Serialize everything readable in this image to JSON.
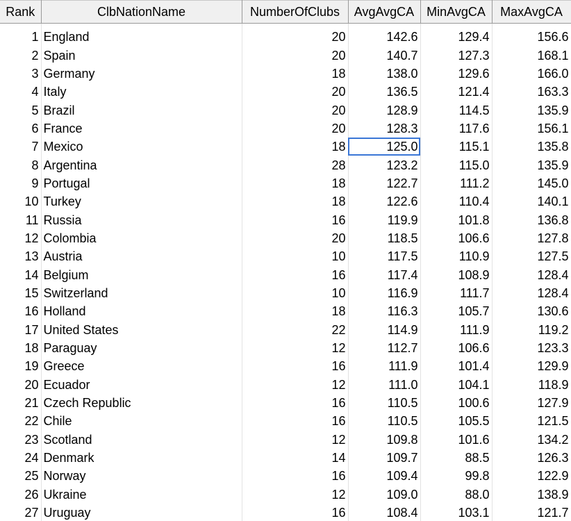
{
  "columns": [
    "Rank",
    "ClbNationName",
    "NumberOfClubs",
    "AvgAvgCA",
    "MinAvgCA",
    "MaxAvgCA"
  ],
  "selected_cell": {
    "row": 7,
    "column": "AvgAvgCA"
  },
  "colors": {
    "header_bg": "#f0f0f0",
    "grid_line": "#e2e2e2",
    "selection": "#3a76d6"
  },
  "rows": [
    {
      "rank": "1",
      "nation": "England",
      "clubs": "20",
      "avg": "142.6",
      "min": "129.4",
      "max": "156.6"
    },
    {
      "rank": "2",
      "nation": "Spain",
      "clubs": "20",
      "avg": "140.7",
      "min": "127.3",
      "max": "168.1"
    },
    {
      "rank": "3",
      "nation": "Germany",
      "clubs": "18",
      "avg": "138.0",
      "min": "129.6",
      "max": "166.0"
    },
    {
      "rank": "4",
      "nation": "Italy",
      "clubs": "20",
      "avg": "136.5",
      "min": "121.4",
      "max": "163.3"
    },
    {
      "rank": "5",
      "nation": "Brazil",
      "clubs": "20",
      "avg": "128.9",
      "min": "114.5",
      "max": "135.9"
    },
    {
      "rank": "6",
      "nation": "France",
      "clubs": "20",
      "avg": "128.3",
      "min": "117.6",
      "max": "156.1"
    },
    {
      "rank": "7",
      "nation": "Mexico",
      "clubs": "18",
      "avg": "125.0",
      "min": "115.1",
      "max": "135.8"
    },
    {
      "rank": "8",
      "nation": "Argentina",
      "clubs": "28",
      "avg": "123.2",
      "min": "115.0",
      "max": "135.9"
    },
    {
      "rank": "9",
      "nation": "Portugal",
      "clubs": "18",
      "avg": "122.7",
      "min": "111.2",
      "max": "145.0"
    },
    {
      "rank": "10",
      "nation": "Turkey",
      "clubs": "18",
      "avg": "122.6",
      "min": "110.4",
      "max": "140.1"
    },
    {
      "rank": "11",
      "nation": "Russia",
      "clubs": "16",
      "avg": "119.9",
      "min": "101.8",
      "max": "136.8"
    },
    {
      "rank": "12",
      "nation": "Colombia",
      "clubs": "20",
      "avg": "118.5",
      "min": "106.6",
      "max": "127.8"
    },
    {
      "rank": "13",
      "nation": "Austria",
      "clubs": "10",
      "avg": "117.5",
      "min": "110.9",
      "max": "127.5"
    },
    {
      "rank": "14",
      "nation": "Belgium",
      "clubs": "16",
      "avg": "117.4",
      "min": "108.9",
      "max": "128.4"
    },
    {
      "rank": "15",
      "nation": "Switzerland",
      "clubs": "10",
      "avg": "116.9",
      "min": "111.7",
      "max": "128.4"
    },
    {
      "rank": "16",
      "nation": "Holland",
      "clubs": "18",
      "avg": "116.3",
      "min": "105.7",
      "max": "130.6"
    },
    {
      "rank": "17",
      "nation": "United States",
      "clubs": "22",
      "avg": "114.9",
      "min": "111.9",
      "max": "119.2"
    },
    {
      "rank": "18",
      "nation": "Paraguay",
      "clubs": "12",
      "avg": "112.7",
      "min": "106.6",
      "max": "123.3"
    },
    {
      "rank": "19",
      "nation": "Greece",
      "clubs": "16",
      "avg": "111.9",
      "min": "101.4",
      "max": "129.9"
    },
    {
      "rank": "20",
      "nation": "Ecuador",
      "clubs": "12",
      "avg": "111.0",
      "min": "104.1",
      "max": "118.9"
    },
    {
      "rank": "21",
      "nation": "Czech Republic",
      "clubs": "16",
      "avg": "110.5",
      "min": "100.6",
      "max": "127.9"
    },
    {
      "rank": "22",
      "nation": "Chile",
      "clubs": "16",
      "avg": "110.5",
      "min": "105.5",
      "max": "121.5"
    },
    {
      "rank": "23",
      "nation": "Scotland",
      "clubs": "12",
      "avg": "109.8",
      "min": "101.6",
      "max": "134.2"
    },
    {
      "rank": "24",
      "nation": "Denmark",
      "clubs": "14",
      "avg": "109.7",
      "min": "88.5",
      "max": "126.3"
    },
    {
      "rank": "25",
      "nation": "Norway",
      "clubs": "16",
      "avg": "109.4",
      "min": "99.8",
      "max": "122.9"
    },
    {
      "rank": "26",
      "nation": "Ukraine",
      "clubs": "12",
      "avg": "109.0",
      "min": "88.0",
      "max": "138.9"
    },
    {
      "rank": "27",
      "nation": "Uruguay",
      "clubs": "16",
      "avg": "108.4",
      "min": "103.1",
      "max": "121.7"
    }
  ]
}
